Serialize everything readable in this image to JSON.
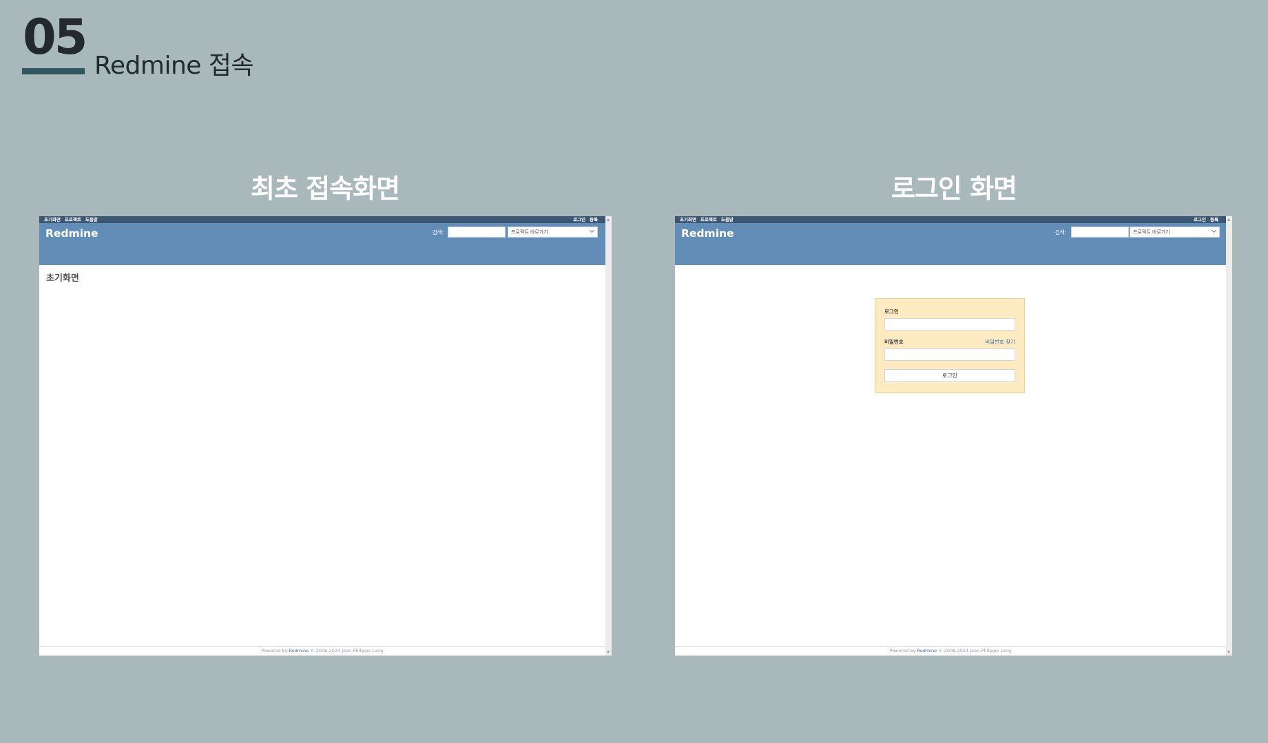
{
  "slide": {
    "number": "05",
    "title": "Redmine 접속",
    "left_caption": "최초 접속화면",
    "right_caption": "로그인 화면"
  },
  "redmine": {
    "top_menu_left": [
      "초기화면",
      "프로젝트",
      "도움말"
    ],
    "top_menu_right": [
      "로그인",
      "등록"
    ],
    "logo": "Redmine",
    "search_label": "검색:",
    "jump_placeholder": "프로젝트 바로가기",
    "footer_prefix": "Powered by ",
    "footer_link": "Redmine",
    "footer_suffix": " © 2006-2024 Jean-Philippe Lang"
  },
  "home_page": {
    "heading": "초기화면"
  },
  "login_page": {
    "login_label": "로그인",
    "password_label": "비밀번호",
    "lost_password": "비밀번호 찾기",
    "submit": "로그인"
  },
  "colors": {
    "slide_background": "#a8b8bb",
    "top_menu": "#3c5774",
    "header": "#628db6",
    "login_box": "#ffebc2",
    "accent_bar": "#2f5560"
  }
}
